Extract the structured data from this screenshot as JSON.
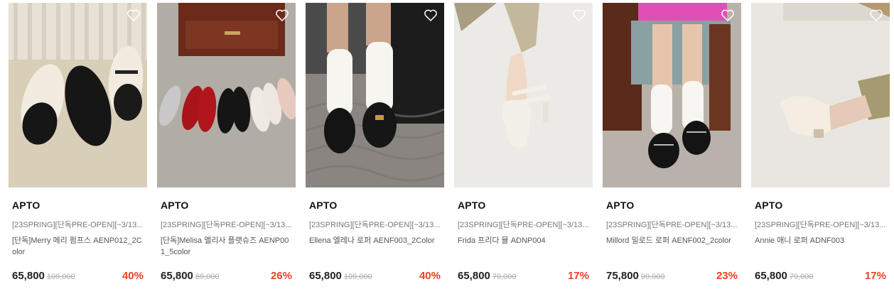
{
  "products": [
    {
      "brand": "APTO",
      "tag": "[23SPRING][단독PRE-OPEN][~3/13...",
      "title": "[단독]Merry 메리 펌프스 AENP012_2Color",
      "sale_price": "65,800",
      "original_price": "109,000",
      "discount": "40%",
      "photo": "mary-jane-pumps-photo",
      "wishlist_icon": "heart-icon"
    },
    {
      "brand": "APTO",
      "tag": "[23SPRING][단독PRE-OPEN][~3/13...",
      "title": "[단독]Melisa 멜리사 플랫슈즈 AENP001_5color",
      "sale_price": "65,800",
      "original_price": "89,000",
      "discount": "26%",
      "photo": "ballet-flats-photo",
      "wishlist_icon": "heart-icon"
    },
    {
      "brand": "APTO",
      "tag": "[23SPRING][단독PRE-OPEN][~3/13...",
      "title": "Ellena 엘레나 로퍼 AENF003_2Color",
      "sale_price": "65,800",
      "original_price": "109,000",
      "discount": "40%",
      "photo": "black-loafers-photo",
      "wishlist_icon": "heart-icon"
    },
    {
      "brand": "APTO",
      "tag": "[23SPRING][단독PRE-OPEN][~3/13...",
      "title": "Frida 프리다 뮬 ADNP004",
      "sale_price": "65,800",
      "original_price": "79,000",
      "discount": "17%",
      "photo": "ivory-mule-photo",
      "wishlist_icon": "heart-icon"
    },
    {
      "brand": "APTO",
      "tag": "[23SPRING][단독PRE-OPEN][~3/13...",
      "title": "Millord 밀로드 로퍼 AENF002_2color",
      "sale_price": "75,800",
      "original_price": "99,000",
      "discount": "23%",
      "photo": "strap-loafers-photo",
      "wishlist_icon": "heart-icon"
    },
    {
      "brand": "APTO",
      "tag": "[23SPRING][단독PRE-OPEN][~3/13...",
      "title": "Annie 애니 로퍼 ADNF003",
      "sale_price": "65,800",
      "original_price": "79,000",
      "discount": "17%",
      "photo": "cream-loafer-photo",
      "wishlist_icon": "heart-icon"
    }
  ],
  "colors": {
    "discount": "#ee3f24",
    "original_price": "#aaaaaa",
    "brand": "#111111"
  }
}
